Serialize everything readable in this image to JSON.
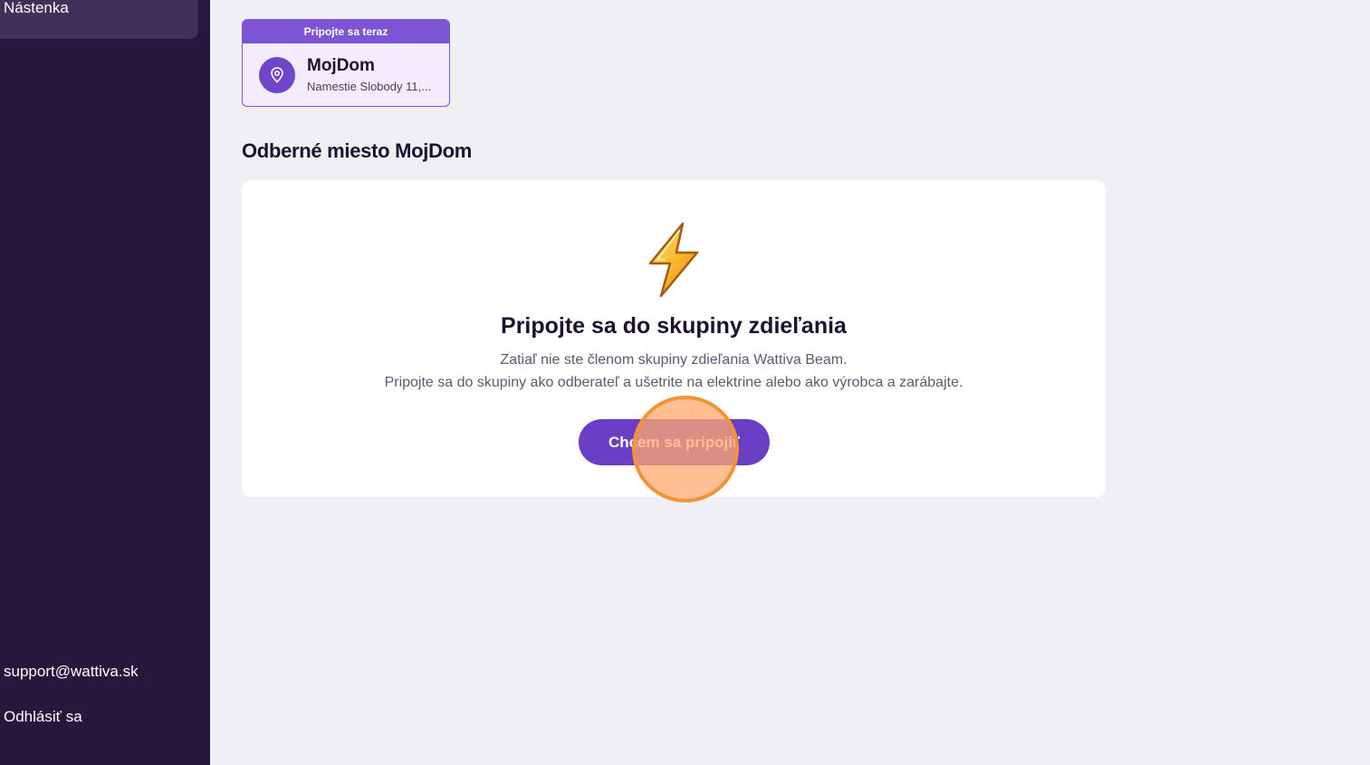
{
  "sidebar": {
    "active_item": "Nástenka",
    "support_email": "support@wattiva.sk",
    "logout_label": "Odhlásiť sa"
  },
  "place_card": {
    "badge": "Pripojte sa teraz",
    "name": "MojDom",
    "address": "Namestie Slobody 11,..."
  },
  "section": {
    "title": "Odberné miesto MojDom"
  },
  "join_card": {
    "title": "Pripojte sa do skupiny zdieľania",
    "text_line_1": "Zatiaľ nie ste členom skupiny zdieľania Wattiva Beam.",
    "text_line_2": "Pripojte sa do skupiny ako odberateľ a ušetrite na elektrine alebo ako výrobca a zarábajte.",
    "button_label": "Chcem sa pripojiť"
  },
  "icons": {
    "place": "map-pin-icon",
    "hero": "lightning-bolt-icon"
  },
  "colors": {
    "sidebar_bg": "#27173d",
    "accent": "#6a3fc6",
    "badge_bg": "#7c55d4",
    "click_marker": "#f39338"
  }
}
